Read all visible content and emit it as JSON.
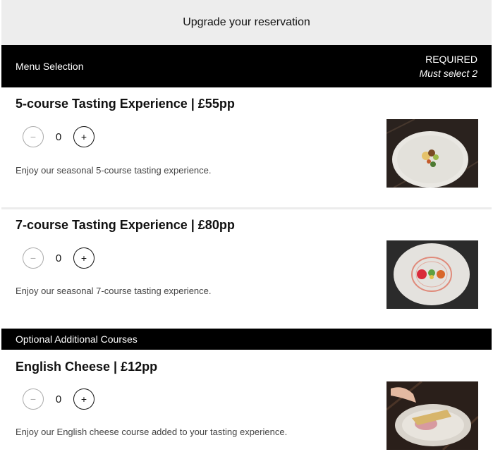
{
  "header": {
    "title": "Upgrade your reservation"
  },
  "menu_section": {
    "title": "Menu Selection",
    "required_label": "REQUIRED",
    "required_note": "Must select 2"
  },
  "items": [
    {
      "title": "5-course Tasting Experience | £55pp",
      "count": "0",
      "minus": "−",
      "plus": "+",
      "description": "Enjoy our seasonal 5-course tasting experience.",
      "photo": "plated-dish-5-course"
    },
    {
      "title": "7-course Tasting Experience | £80pp",
      "count": "0",
      "minus": "−",
      "plus": "+",
      "description": "Enjoy our seasonal 7-course tasting experience.",
      "photo": "plated-dish-7-course"
    }
  ],
  "optional_section": {
    "title": "Optional Additional Courses"
  },
  "optional_items": [
    {
      "title": "English Cheese | £12pp",
      "count": "0",
      "minus": "−",
      "plus": "+",
      "description": "Enjoy our English cheese course added to your tasting experience.",
      "photo": "cheese-course-dish"
    }
  ]
}
